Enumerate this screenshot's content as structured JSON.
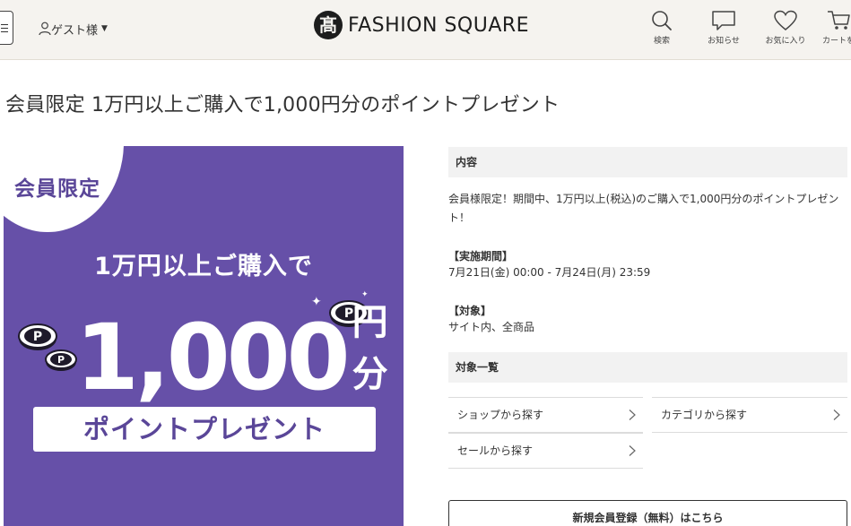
{
  "header": {
    "guest_label": "ゲスト様",
    "caret": "▼",
    "logo_mark_char": "髙",
    "logo_text": "FASHION SQUARE",
    "nav": {
      "search": "検索",
      "notice": "お知らせ",
      "favorites": "お気に入り",
      "cart": "カートを"
    }
  },
  "page": {
    "title": "会員限定 1万円以上ご購入で1,000円分のポイントプレゼント"
  },
  "banner": {
    "badge": "会員限定",
    "line1": "1万円以上ご購入で",
    "amount": "1,000",
    "unit": "円分",
    "present": "ポイントプレゼント",
    "coin_char": "P",
    "colors": {
      "background": "#6650a8",
      "accent": "#5a4698"
    }
  },
  "details": {
    "content_heading": "内容",
    "content_text": "会員様限定！期間中、1万円以上(税込)のご購入で1,000円分のポイントプレゼント！",
    "period_label": "【実施期間】",
    "period_value": "7月21日(金) 00:00 - 7月24日(月) 23:59",
    "target_label": "【対象】",
    "target_value": "サイト内、全商品",
    "list_heading": "対象一覧",
    "links": {
      "shop": "ショップから探す",
      "category": "カテゴリから探す",
      "sale": "セールから探す"
    },
    "register_button": "新規会員登録（無料）はこちら"
  }
}
